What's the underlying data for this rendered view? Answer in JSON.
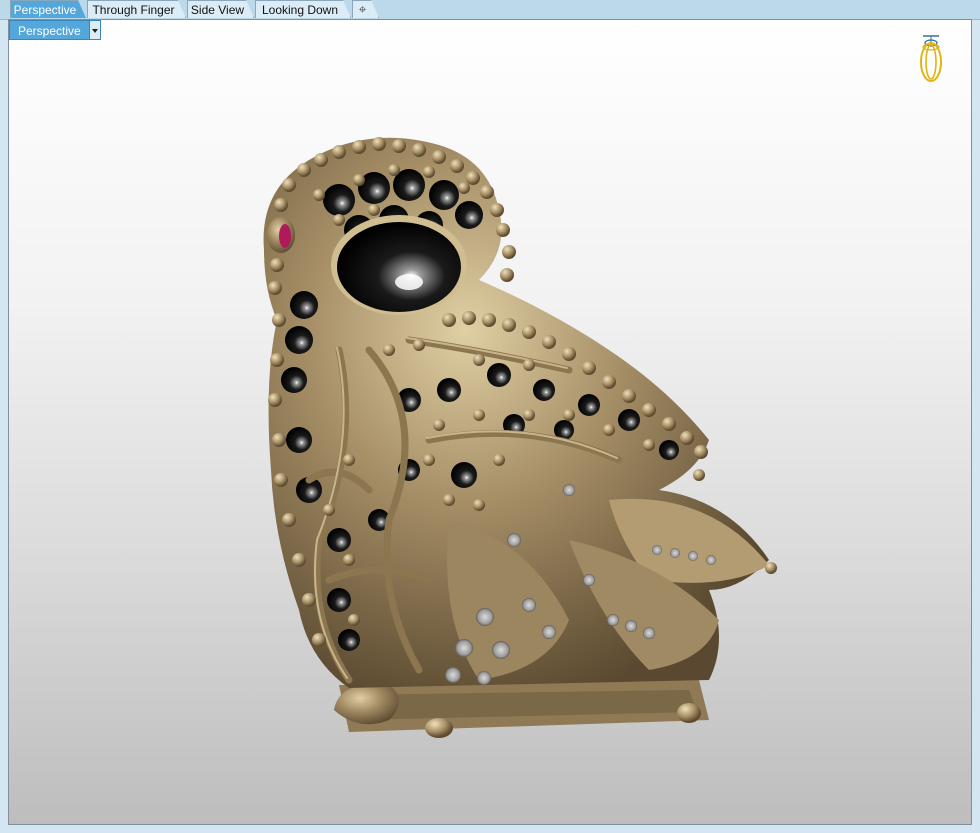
{
  "tabs": [
    {
      "label": "Perspective",
      "active": true
    },
    {
      "label": "Through Finger",
      "active": false
    },
    {
      "label": "Side View",
      "active": false
    },
    {
      "label": "Looking Down",
      "active": false
    }
  ],
  "add_tab_icon": "plus-icon",
  "viewport": {
    "label": "Perspective",
    "dropdown_icon": "chevron-down-icon",
    "orientation_icon": "ring-orientation-icon"
  },
  "colors": {
    "tab_active": "#54a7da",
    "metal": "#a58e66",
    "gem_black": "#1b1b1b",
    "gem_red": "#b01a5a"
  }
}
